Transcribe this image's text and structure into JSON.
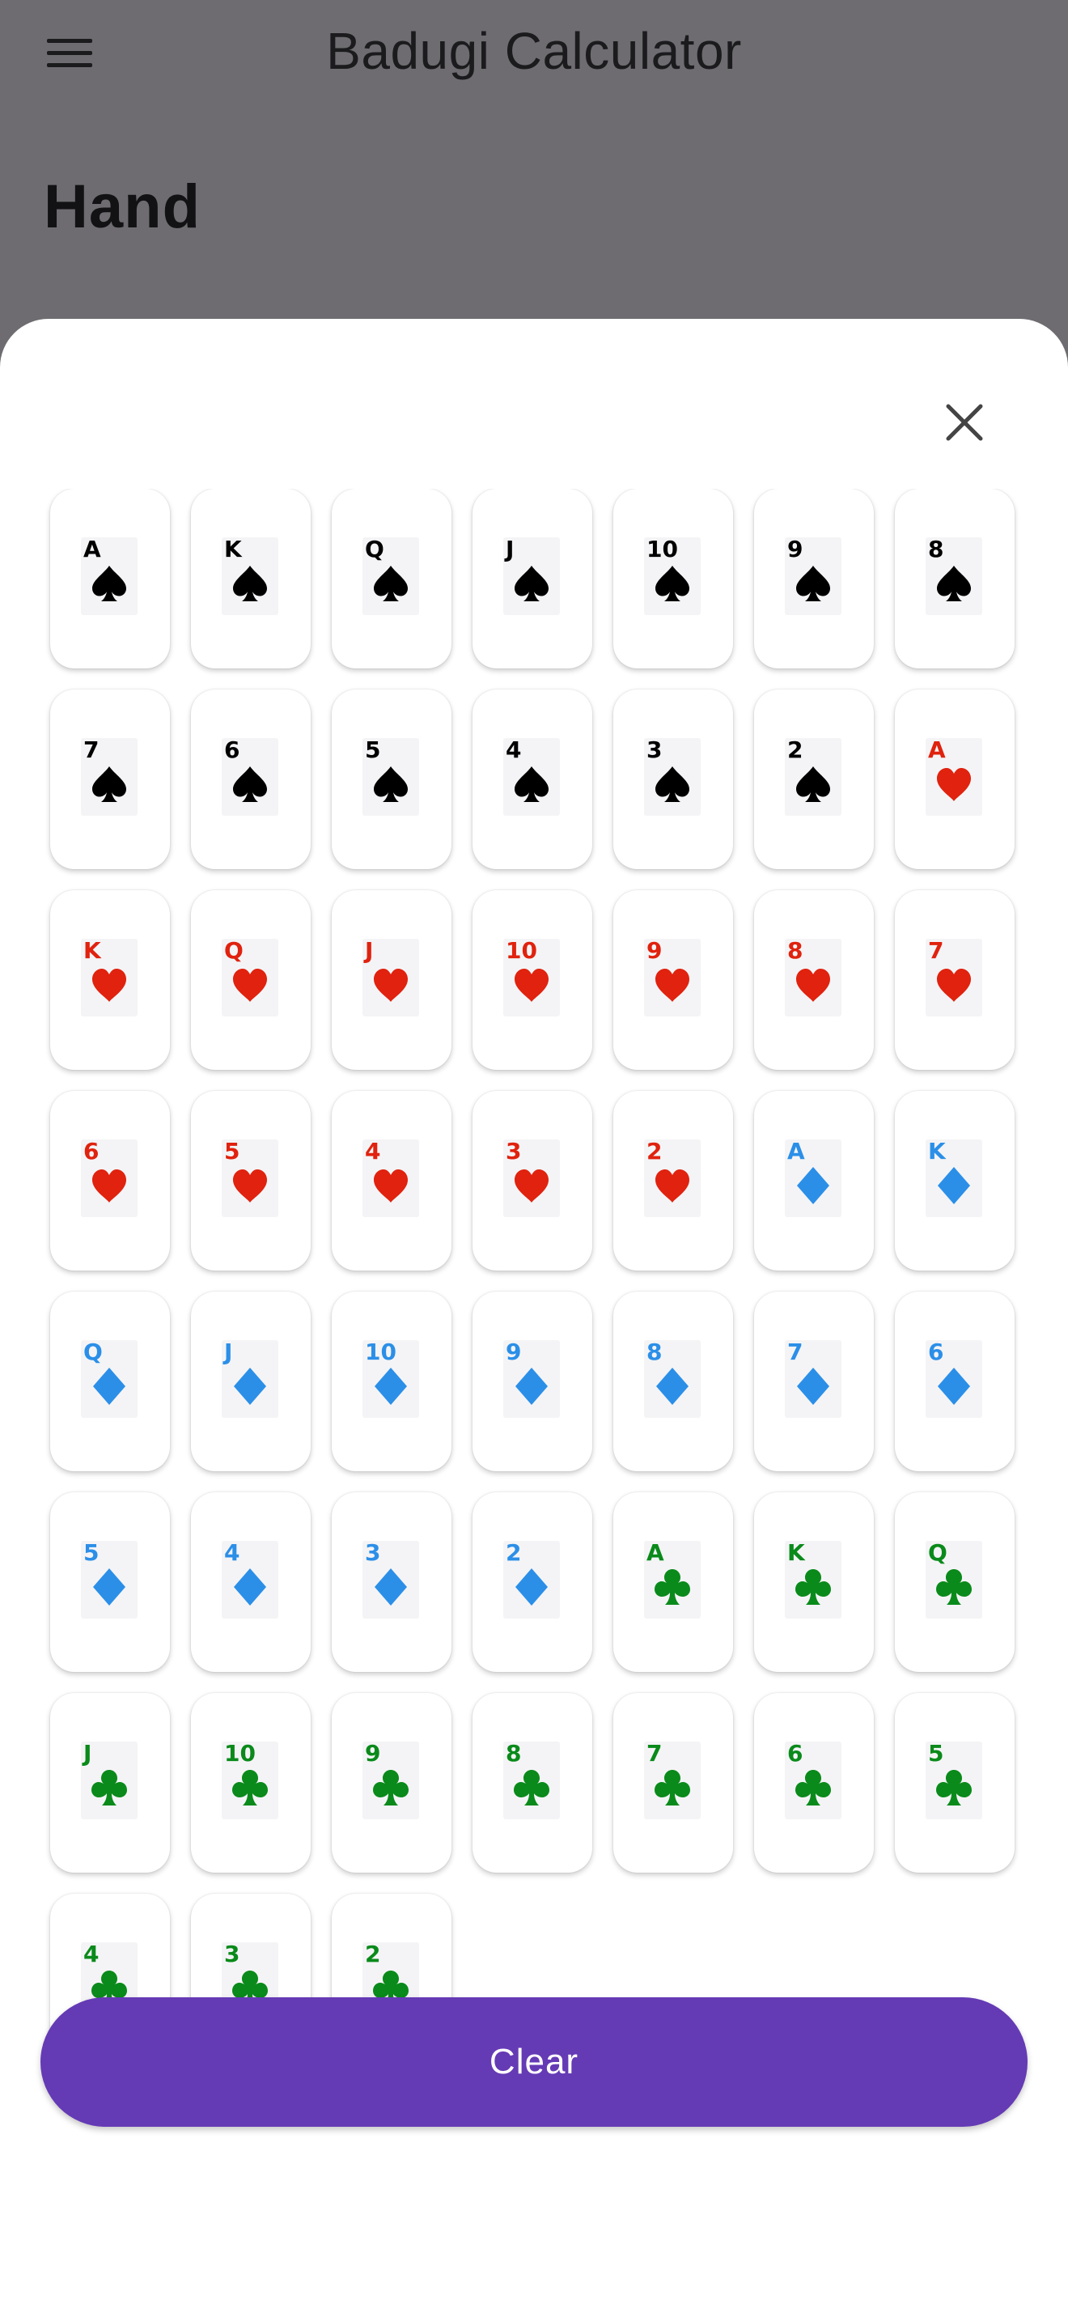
{
  "app": {
    "title": "Badugi Calculator"
  },
  "icons": {
    "menu": "hamburger-menu-icon",
    "close": "close-icon"
  },
  "section": {
    "title": "Hand"
  },
  "colors": {
    "spades": "#000000",
    "hearts": "#e0220e",
    "diamonds": "#2b8fe8",
    "clubs": "#0a8a1a",
    "accent": "#653ab5"
  },
  "cards": [
    {
      "rank": "A",
      "suit": "spades"
    },
    {
      "rank": "K",
      "suit": "spades"
    },
    {
      "rank": "Q",
      "suit": "spades"
    },
    {
      "rank": "J",
      "suit": "spades"
    },
    {
      "rank": "10",
      "suit": "spades"
    },
    {
      "rank": "9",
      "suit": "spades"
    },
    {
      "rank": "8",
      "suit": "spades"
    },
    {
      "rank": "7",
      "suit": "spades"
    },
    {
      "rank": "6",
      "suit": "spades"
    },
    {
      "rank": "5",
      "suit": "spades"
    },
    {
      "rank": "4",
      "suit": "spades"
    },
    {
      "rank": "3",
      "suit": "spades"
    },
    {
      "rank": "2",
      "suit": "spades"
    },
    {
      "rank": "A",
      "suit": "hearts"
    },
    {
      "rank": "K",
      "suit": "hearts"
    },
    {
      "rank": "Q",
      "suit": "hearts"
    },
    {
      "rank": "J",
      "suit": "hearts"
    },
    {
      "rank": "10",
      "suit": "hearts"
    },
    {
      "rank": "9",
      "suit": "hearts"
    },
    {
      "rank": "8",
      "suit": "hearts"
    },
    {
      "rank": "7",
      "suit": "hearts"
    },
    {
      "rank": "6",
      "suit": "hearts"
    },
    {
      "rank": "5",
      "suit": "hearts"
    },
    {
      "rank": "4",
      "suit": "hearts"
    },
    {
      "rank": "3",
      "suit": "hearts"
    },
    {
      "rank": "2",
      "suit": "hearts"
    },
    {
      "rank": "A",
      "suit": "diamonds"
    },
    {
      "rank": "K",
      "suit": "diamonds"
    },
    {
      "rank": "Q",
      "suit": "diamonds"
    },
    {
      "rank": "J",
      "suit": "diamonds"
    },
    {
      "rank": "10",
      "suit": "diamonds"
    },
    {
      "rank": "9",
      "suit": "diamonds"
    },
    {
      "rank": "8",
      "suit": "diamonds"
    },
    {
      "rank": "7",
      "suit": "diamonds"
    },
    {
      "rank": "6",
      "suit": "diamonds"
    },
    {
      "rank": "5",
      "suit": "diamonds"
    },
    {
      "rank": "4",
      "suit": "diamonds"
    },
    {
      "rank": "3",
      "suit": "diamonds"
    },
    {
      "rank": "2",
      "suit": "diamonds"
    },
    {
      "rank": "A",
      "suit": "clubs"
    },
    {
      "rank": "K",
      "suit": "clubs"
    },
    {
      "rank": "Q",
      "suit": "clubs"
    },
    {
      "rank": "J",
      "suit": "clubs"
    },
    {
      "rank": "10",
      "suit": "clubs"
    },
    {
      "rank": "9",
      "suit": "clubs"
    },
    {
      "rank": "8",
      "suit": "clubs"
    },
    {
      "rank": "7",
      "suit": "clubs"
    },
    {
      "rank": "6",
      "suit": "clubs"
    },
    {
      "rank": "5",
      "suit": "clubs"
    },
    {
      "rank": "4",
      "suit": "clubs"
    },
    {
      "rank": "3",
      "suit": "clubs"
    },
    {
      "rank": "2",
      "suit": "clubs"
    }
  ],
  "actions": {
    "clear_label": "Clear"
  }
}
